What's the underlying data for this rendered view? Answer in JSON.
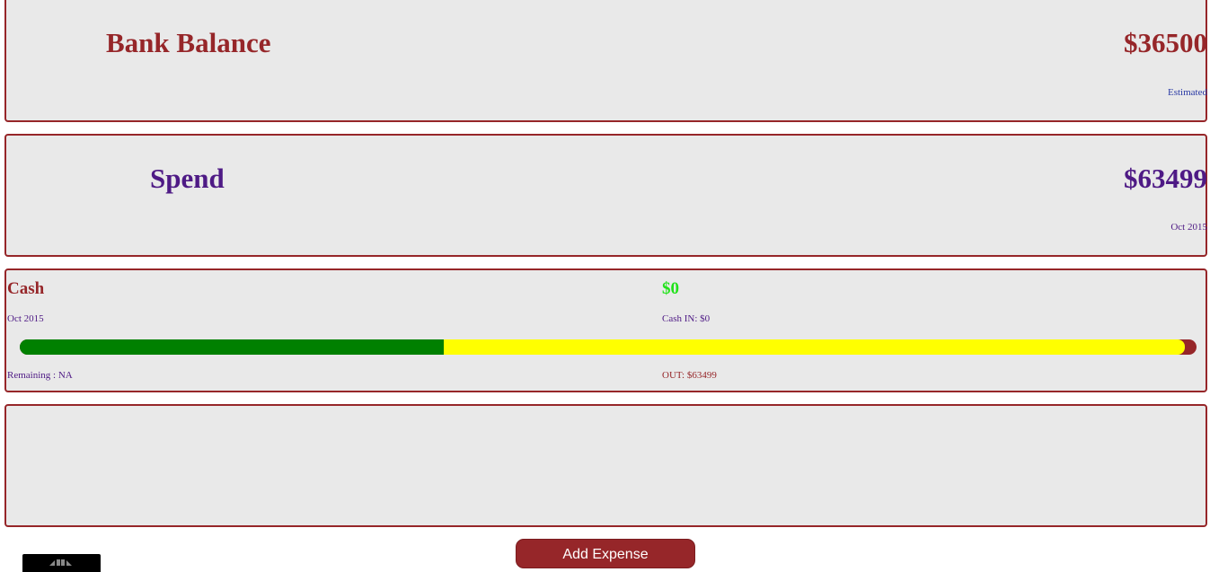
{
  "bank_balance": {
    "title": "Bank Balance",
    "value": "$36500",
    "note": "Estimated"
  },
  "spend": {
    "title": "Spend",
    "value": "$63499",
    "note": "Oct 2015"
  },
  "cash": {
    "title": "Cash",
    "period": "Oct 2015",
    "amount": "$0",
    "cash_in": "Cash IN: $0",
    "remaining": "Remaining : NA",
    "out": "OUT: $63499",
    "progress": {
      "green_fraction": 0.36,
      "yellow_fraction": 0.63,
      "colors": {
        "green": "#008000",
        "yellow": "#ffff00",
        "track": "#962629"
      }
    }
  },
  "actions": {
    "add_expense_label": "Add Expense"
  },
  "colors": {
    "accent_red": "#962629",
    "accent_purple": "#4e1a85",
    "link_blue": "#2a3aa5",
    "positive_green": "#21e21a",
    "card_background": "#e9e9e9"
  },
  "icons": {
    "corner_widget": "home-icon"
  }
}
